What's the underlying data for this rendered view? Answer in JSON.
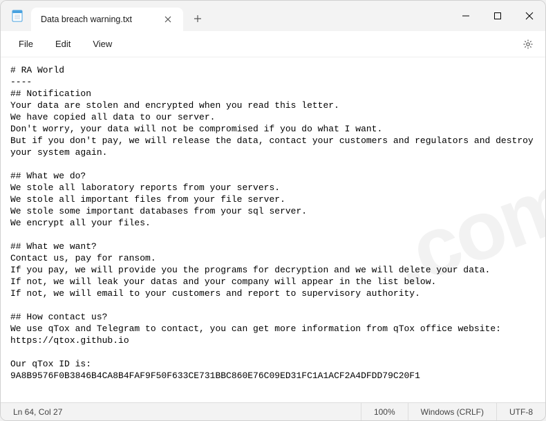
{
  "titlebar": {
    "tab_title": "Data breach warning.txt"
  },
  "menubar": {
    "file": "File",
    "edit": "Edit",
    "view": "View"
  },
  "content": {
    "text": "# RA World\n----\n## Notification\nYour data are stolen and encrypted when you read this letter.\nWe have copied all data to our server.\nDon't worry, your data will not be compromised if you do what I want.\nBut if you don't pay, we will release the data, contact your customers and regulators and destroy your system again.\n\n## What we do?\nWe stole all laboratory reports from your servers.\nWe stole all important files from your file server.\nWe stole some important databases from your sql server.\nWe encrypt all your files.\n\n## What we want?\nContact us, pay for ransom.\nIf you pay, we will provide you the programs for decryption and we will delete your data.\nIf not, we will leak your datas and your company will appear in the list below.\nIf not, we will email to your customers and report to supervisory authority.\n\n## How contact us?\nWe use qTox and Telegram to contact, you can get more information from qTox office website:\nhttps://qtox.github.io\n\nOur qTox ID is:\n9A8B9576F0B3846B4CA8B4FAF9F50F633CE731BBC860E76C09ED31FC1A1ACF2A4DFDD79C20F1"
  },
  "statusbar": {
    "cursor": "Ln 64, Col 27",
    "zoom": "100%",
    "line_ending": "Windows (CRLF)",
    "encoding": "UTF-8"
  },
  "watermark": ".com"
}
